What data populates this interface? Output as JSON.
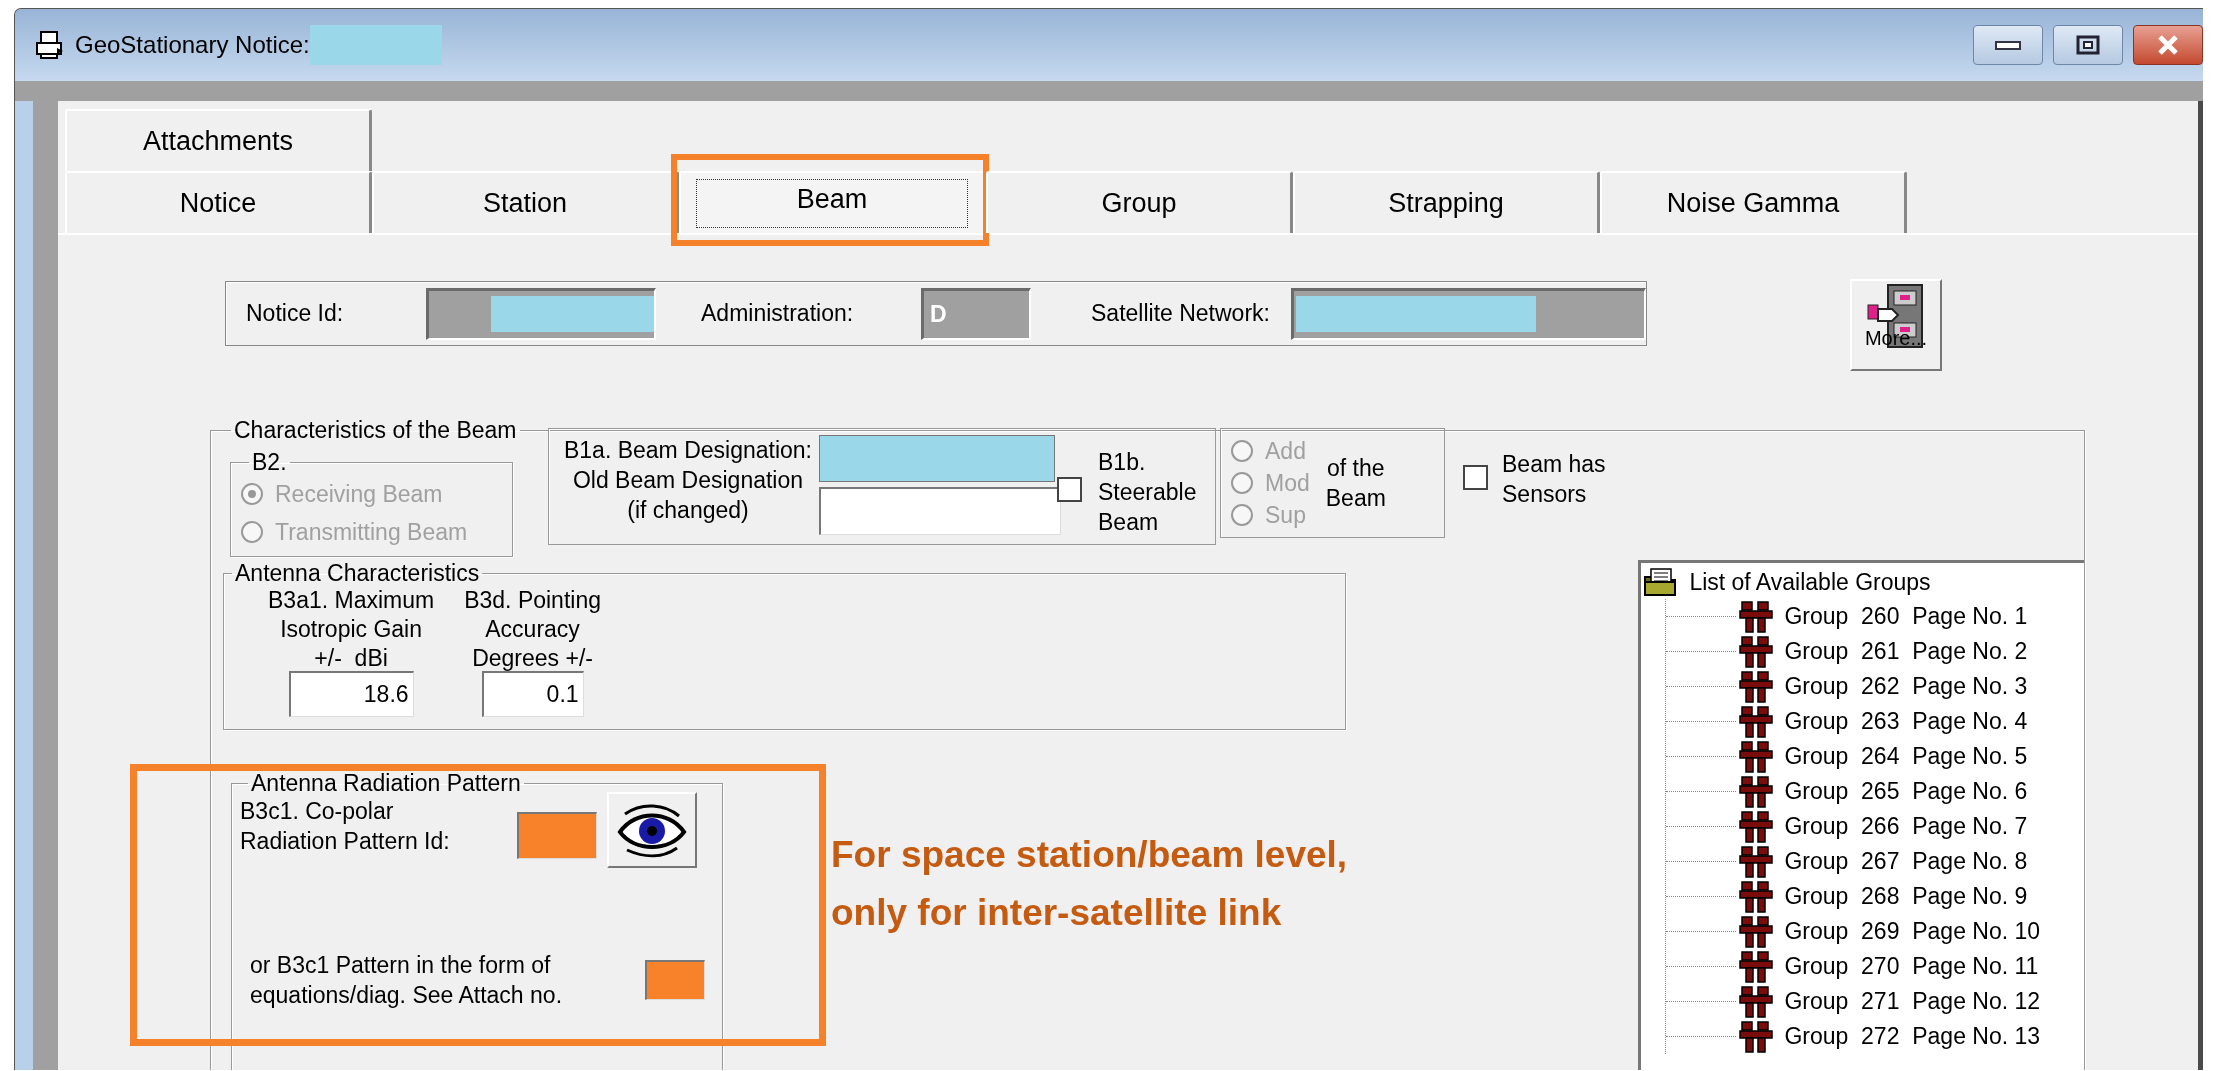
{
  "window": {
    "title": "GeoStationary Notice:",
    "title_redacted": true
  },
  "tab_rows": [
    [
      {
        "label": "Attachments",
        "selected": false,
        "highlighted": false
      }
    ],
    [
      {
        "label": "Notice",
        "selected": false,
        "highlighted": false
      },
      {
        "label": "Station",
        "selected": false,
        "highlighted": false
      },
      {
        "label": "Beam",
        "selected": true,
        "highlighted": true
      },
      {
        "label": "Group",
        "selected": false,
        "highlighted": false
      },
      {
        "label": "Strapping",
        "selected": false,
        "highlighted": false
      },
      {
        "label": "Noise Gamma",
        "selected": false,
        "highlighted": false
      }
    ]
  ],
  "header": {
    "notice_id": {
      "label": "Notice Id:",
      "redacted": true
    },
    "administration": {
      "label": "Administration:",
      "value": "D"
    },
    "satellite_network": {
      "label": "Satellite Network:",
      "redacted": true
    }
  },
  "more_button": {
    "label": "More..."
  },
  "characteristics": {
    "title": "Characteristics of the Beam",
    "b2": {
      "title": "B2.",
      "options": [
        {
          "label": "Receiving Beam",
          "selected": true,
          "disabled": true
        },
        {
          "label": "Transmitting Beam",
          "selected": false,
          "disabled": true
        }
      ]
    },
    "designation": {
      "label": "B1a. Beam Designation:",
      "redacted": true,
      "old_label": "Old Beam Designation\n(if changed)"
    },
    "steerable": {
      "label": "B1b.\nSteerable\nBeam",
      "checked": false
    },
    "action": {
      "options": [
        {
          "label": "Add",
          "selected": false,
          "disabled": true
        },
        {
          "label": "Mod",
          "selected": false,
          "disabled": true
        },
        {
          "label": "Sup",
          "selected": false,
          "disabled": true
        }
      ],
      "label": "of the\nBeam"
    },
    "sensors": {
      "label": "Beam has\nSensors",
      "checked": false
    },
    "antenna": {
      "title": "Antenna Characteristics",
      "fields": [
        {
          "label": "B3a1. Maximum\nIsotropic Gain\n+/-  dBi",
          "value": "18.6"
        },
        {
          "label": "B3d. Pointing\nAccuracy\nDegrees +/-",
          "value": "0.1"
        }
      ]
    },
    "radiation": {
      "title": "Antenna Radiation Pattern",
      "highlighted": true,
      "copolar": {
        "label": "B3c1. Co-polar\nRadiation Pattern Id:",
        "highlighted": true
      },
      "equations": {
        "label": "or B3c1 Pattern in the form of\nequations/diag. See Attach no.",
        "highlighted": true
      }
    }
  },
  "groups_tree": {
    "title": "List of Available Groups",
    "children": [
      {
        "label": "Group  260  Page No. 1"
      },
      {
        "label": "Group  261  Page No. 2"
      },
      {
        "label": "Group  262  Page No. 3"
      },
      {
        "label": "Group  263  Page No. 4"
      },
      {
        "label": "Group  264  Page No. 5"
      },
      {
        "label": "Group  265  Page No. 6"
      },
      {
        "label": "Group  266  Page No. 7"
      },
      {
        "label": "Group  267  Page No. 8"
      },
      {
        "label": "Group  268  Page No. 9"
      },
      {
        "label": "Group  269  Page No. 10"
      },
      {
        "label": "Group  270  Page No. 11"
      },
      {
        "label": "Group  271  Page No. 12"
      },
      {
        "label": "Group  272  Page No. 13"
      }
    ]
  },
  "annotation": {
    "text": "For space station/beam level,\nonly for inter-satellite link"
  }
}
